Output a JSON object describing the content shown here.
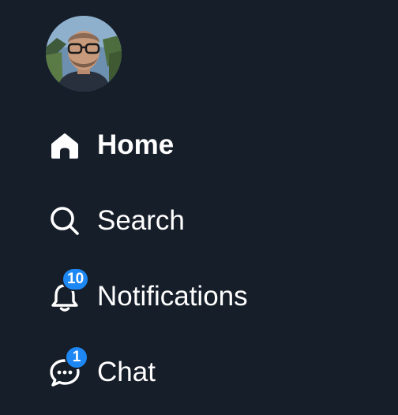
{
  "user": {
    "avatar_icon": "user-avatar-photo"
  },
  "nav": {
    "items": [
      {
        "label": "Home",
        "icon": "home-icon",
        "active": true
      },
      {
        "label": "Search",
        "icon": "search-icon",
        "active": false
      },
      {
        "label": "Notifications",
        "icon": "bell-icon",
        "badge": "10",
        "active": false
      },
      {
        "label": "Chat",
        "icon": "chat-bubble-icon",
        "badge": "1",
        "active": false
      }
    ]
  },
  "colors": {
    "background": "#161e2a",
    "text": "#ffffff",
    "badge": "#1d87f4"
  }
}
